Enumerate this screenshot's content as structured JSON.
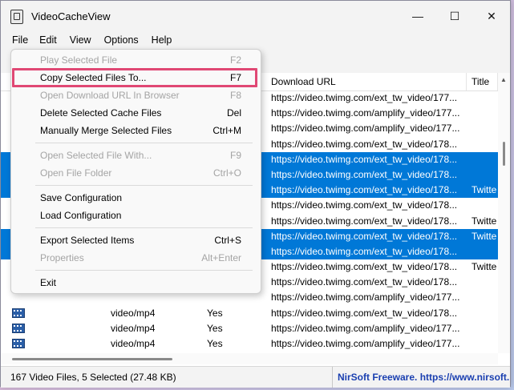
{
  "window": {
    "title": "VideoCacheView",
    "minimize": "—",
    "maximize": "☐",
    "close": "✕"
  },
  "menubar": [
    "File",
    "Edit",
    "View",
    "Options",
    "Help"
  ],
  "file_menu": [
    {
      "label": "Play Selected File",
      "shortcut": "F2",
      "disabled": true
    },
    {
      "label": "Copy Selected Files To...",
      "shortcut": "F7",
      "disabled": false,
      "highlighted": true
    },
    {
      "label": "Open Download URL In Browser",
      "shortcut": "F8",
      "disabled": true
    },
    {
      "label": "Delete Selected Cache Files",
      "shortcut": "Del",
      "disabled": false
    },
    {
      "label": "Manually Merge Selected Files",
      "shortcut": "Ctrl+M",
      "disabled": false
    },
    {
      "label": "Open Selected File With...",
      "shortcut": "F9",
      "disabled": true
    },
    {
      "label": "Open File Folder",
      "shortcut": "Ctrl+O",
      "disabled": true
    },
    {
      "label": "Save Configuration",
      "shortcut": "",
      "disabled": false
    },
    {
      "label": "Load Configuration",
      "shortcut": "",
      "disabled": false
    },
    {
      "label": "Export Selected Items",
      "shortcut": "Ctrl+S",
      "disabled": false
    },
    {
      "label": "Properties",
      "shortcut": "Alt+Enter",
      "disabled": true
    },
    {
      "label": "Exit",
      "shortcut": "",
      "disabled": false
    }
  ],
  "columns": {
    "url": "Download URL",
    "title": "Title"
  },
  "rows": [
    {
      "type": "",
      "yes": "",
      "url": "https://video.twimg.com/ext_tw_video/177...",
      "title": "",
      "selected": false
    },
    {
      "type": "",
      "yes": "",
      "url": "https://video.twimg.com/amplify_video/177...",
      "title": "",
      "selected": false
    },
    {
      "type": "",
      "yes": "",
      "url": "https://video.twimg.com/amplify_video/177...",
      "title": "",
      "selected": false
    },
    {
      "type": "",
      "yes": "",
      "url": "https://video.twimg.com/ext_tw_video/178...",
      "title": "",
      "selected": false
    },
    {
      "type": "",
      "yes": "",
      "url": "https://video.twimg.com/ext_tw_video/178...",
      "title": "",
      "selected": true
    },
    {
      "type": "",
      "yes": "",
      "url": "https://video.twimg.com/ext_tw_video/178...",
      "title": "",
      "selected": true
    },
    {
      "type": "",
      "yes": "",
      "url": "https://video.twimg.com/ext_tw_video/178...",
      "title": "Twitte",
      "selected": true
    },
    {
      "type": "",
      "yes": "",
      "url": "https://video.twimg.com/ext_tw_video/178...",
      "title": "",
      "selected": false
    },
    {
      "type": "",
      "yes": "",
      "url": "https://video.twimg.com/ext_tw_video/178...",
      "title": "Twitte",
      "selected": false
    },
    {
      "type": "",
      "yes": "",
      "url": "https://video.twimg.com/ext_tw_video/178...",
      "title": "Twitte",
      "selected": true
    },
    {
      "type": "",
      "yes": "",
      "url": "https://video.twimg.com/ext_tw_video/178...",
      "title": "",
      "selected": true
    },
    {
      "type": "",
      "yes": "",
      "url": "https://video.twimg.com/ext_tw_video/178...",
      "title": "Twitte",
      "selected": false
    },
    {
      "type": "",
      "yes": "",
      "url": "https://video.twimg.com/ext_tw_video/178...",
      "title": "",
      "selected": false
    },
    {
      "type": "",
      "yes": "",
      "url": "https://video.twimg.com/amplify_video/177...",
      "title": "",
      "selected": false
    },
    {
      "type": "video/mp4",
      "yes": "Yes",
      "url": "https://video.twimg.com/ext_tw_video/178...",
      "title": "",
      "selected": false,
      "icon": true
    },
    {
      "type": "video/mp4",
      "yes": "Yes",
      "url": "https://video.twimg.com/amplify_video/177...",
      "title": "",
      "selected": false,
      "icon": true
    },
    {
      "type": "video/mp4",
      "yes": "Yes",
      "url": "https://video.twimg.com/amplify_video/177...",
      "title": "",
      "selected": false,
      "icon": true
    },
    {
      "type": "video/mp4",
      "yes": "Yes",
      "url": "https://video.twimg.com/amplify_video/177...",
      "title": "",
      "selected": false,
      "icon": true
    }
  ],
  "status": {
    "left": "167 Video Files, 5 Selected  (27.48 KB)",
    "right": "NirSoft Freeware. https://www.nirsoft.n"
  },
  "colors": {
    "selection": "#0078d7",
    "highlight_box": "#e04874",
    "link": "#1a3fb0"
  }
}
